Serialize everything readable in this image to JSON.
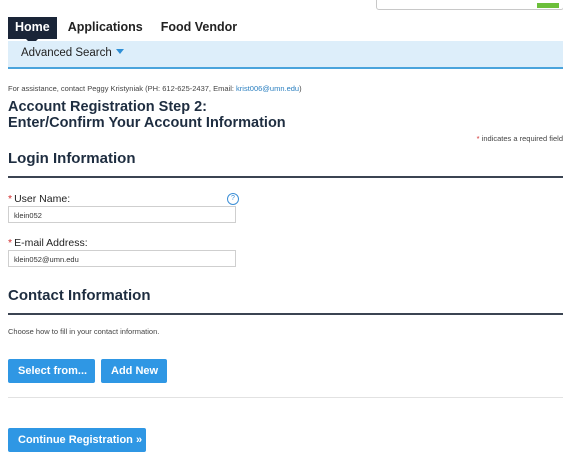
{
  "nav": {
    "tabs": [
      "Home",
      "Applications",
      "Food Vendor"
    ]
  },
  "subnav": {
    "advanced_search": "Advanced Search"
  },
  "assistance": {
    "prefix": "For assistance, contact Peggy Kristyniak (PH: 612-625-2437, Email: ",
    "email": "krist006@umn.edu",
    "suffix": ")"
  },
  "step": {
    "line1": "Account Registration Step 2:",
    "line2": "Enter/Confirm Your Account Information"
  },
  "required_note": "indicates a required field",
  "login": {
    "heading": "Login Information",
    "username_label": "User Name:",
    "username_value": "klein052",
    "email_label": "E-mail Address:",
    "email_value": "klein052@umn.edu"
  },
  "contact": {
    "heading": "Contact Information",
    "hint": "Choose how to fill in your contact information.",
    "select_button": "Select from...",
    "add_button": "Add New"
  },
  "continue_button": "Continue Registration »",
  "colors": {
    "accent": "#2f97e4",
    "nav_active": "#1a2538",
    "required": "#d12c2c"
  }
}
